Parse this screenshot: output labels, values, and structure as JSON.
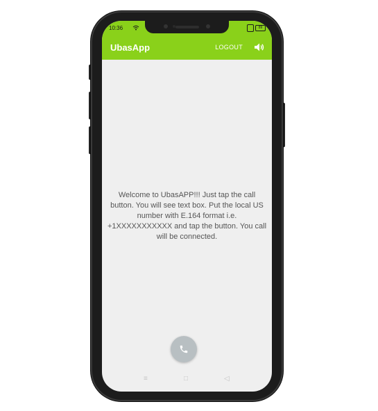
{
  "statusbar": {
    "time": "10:36",
    "battery": "89"
  },
  "appbar": {
    "title": "UbasApp",
    "logout_label": "LOGOUT",
    "sound_icon": "volume-icon"
  },
  "main": {
    "welcome_text": "Welcome to UbasAPP!!! Just tap the call button. You will see text box. Put the local US number with E.164 format i.e. +1XXXXXXXXXXX and tap the button. You call will be connected.",
    "call_icon": "phone-icon"
  },
  "navbar": {
    "menu_icon": "≡",
    "home_icon": "□",
    "back_icon": "◁"
  },
  "colors": {
    "accent": "#8ad11a",
    "fab": "#b8bfc2",
    "background": "#efefef",
    "text": "#555555"
  }
}
